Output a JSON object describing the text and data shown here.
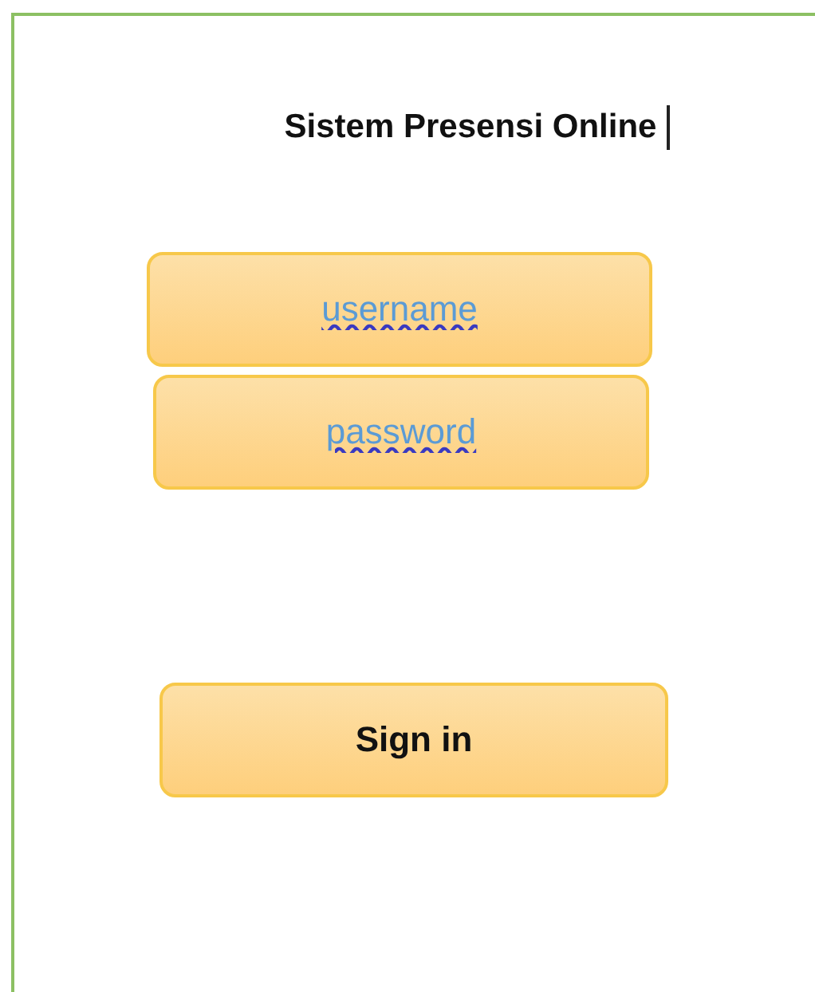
{
  "title": "Sistem Presensi Online",
  "fields": [
    {
      "placeholder": "username"
    },
    {
      "placeholder": "password"
    }
  ],
  "button": "Sign in"
}
